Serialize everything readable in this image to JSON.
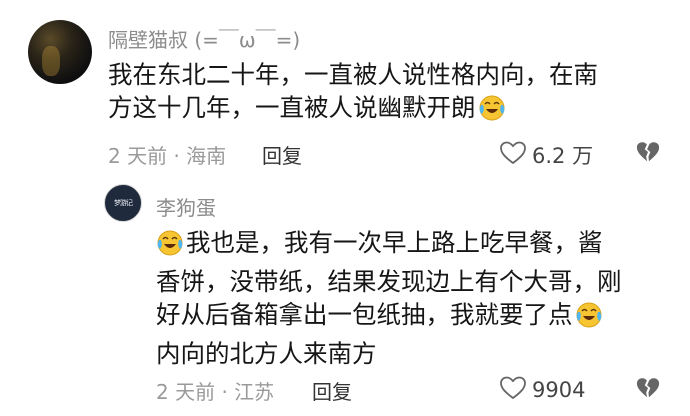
{
  "comments": [
    {
      "username": "隔壁猫叔 (=￣ω￣=)",
      "text_line1": "我在东北二十年，一直被人说性格内向，在南",
      "text_line2": "方这十几年，一直被人说幽默开朗",
      "meta": "2 天前 · 海南",
      "reply_label": "回复",
      "likes": "6.2 万"
    },
    {
      "username": "李狗蛋",
      "avatar_text": "梦游记",
      "text_line1": "我也是，我有一次早上路上吃早餐，酱",
      "text_line2": "香饼，没带纸，结果发现边上有个大哥，刚",
      "text_line3": "好从后备箱拿出一包纸抽，我就要了点",
      "text_line4": "内向的北方人来南方",
      "meta": "2 天前 · 江苏",
      "reply_label": "回复",
      "likes": "9904"
    }
  ],
  "icons": {
    "like": "heart-outline-icon",
    "dislike": "broken-heart-icon",
    "emoji": "tears-of-joy-emoji-icon"
  },
  "colors": {
    "username": "#8c8c8c",
    "text": "#161616",
    "meta": "#9a9a9a",
    "emoji": "#f7c531"
  }
}
